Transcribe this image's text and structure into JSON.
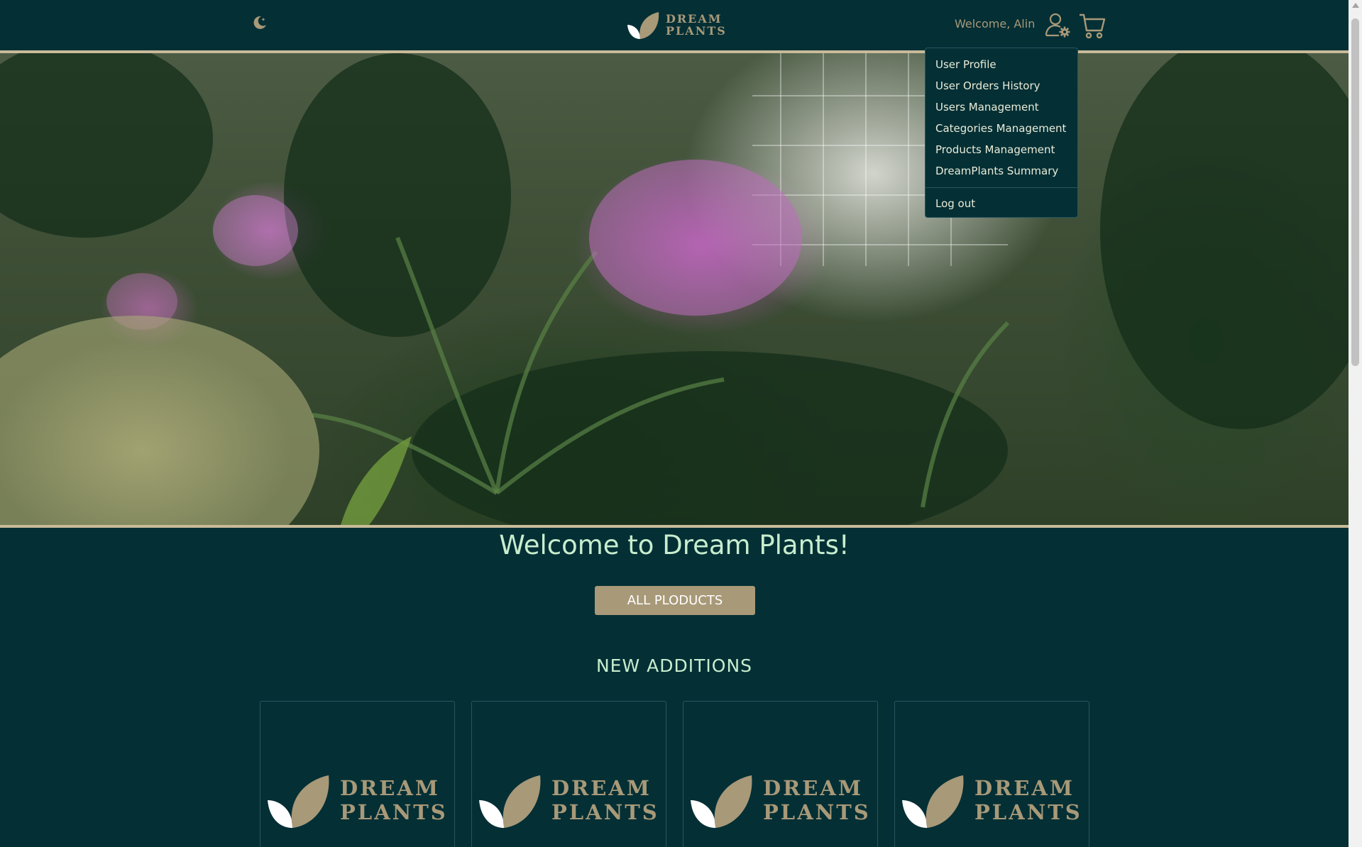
{
  "header": {
    "welcome_text": "Welcome, Alin",
    "logo_line1": "DREAM",
    "logo_line2": "PLANTS"
  },
  "icons": {
    "theme_toggle": "moon-icon",
    "user": "user-settings-icon",
    "cart": "cart-icon"
  },
  "dropdown": {
    "items": [
      {
        "label": "User Profile"
      },
      {
        "label": "User Orders History"
      },
      {
        "label": "Users Management"
      },
      {
        "label": "Categories Management"
      },
      {
        "label": "Products Management"
      },
      {
        "label": "DreamPlants Summary"
      }
    ],
    "logout_label": "Log out"
  },
  "main": {
    "title": "Welcome to Dream Plants!",
    "cta_label": "ALL PLODUCTS",
    "section_title": "NEW ADDITIONS"
  },
  "products": [
    {
      "logo_line1": "DREAM",
      "logo_line2": "PLANTS"
    },
    {
      "logo_line1": "DREAM",
      "logo_line2": "PLANTS"
    },
    {
      "logo_line1": "DREAM",
      "logo_line2": "PLANTS"
    },
    {
      "logo_line1": "DREAM",
      "logo_line2": "PLANTS"
    }
  ],
  "colors": {
    "background": "#042f35",
    "accent": "#a89978",
    "heading": "#c8edce",
    "hero_border": "#c8bb99"
  }
}
